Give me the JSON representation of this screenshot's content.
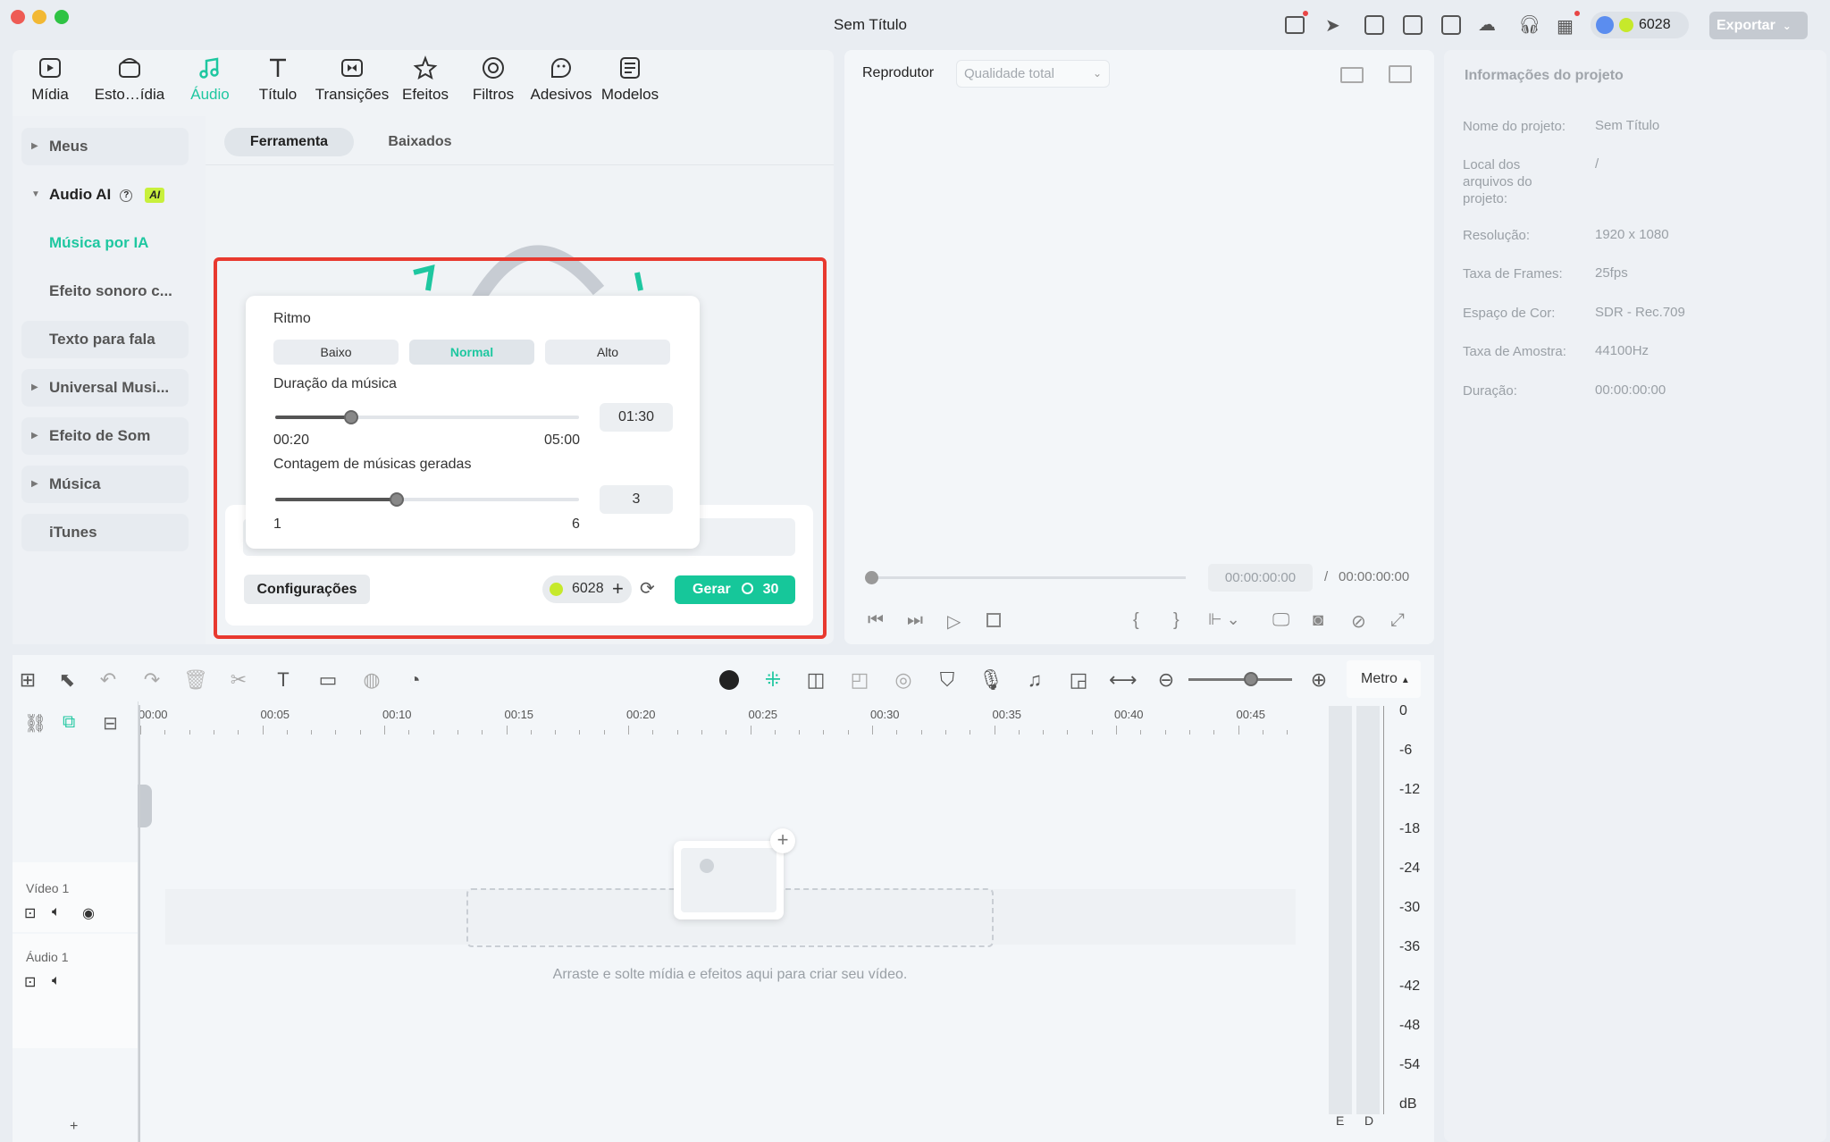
{
  "window": {
    "title": "Sem Título",
    "credits": "6028",
    "export_label": "Exportar"
  },
  "media_tabs": [
    {
      "label": "Mídia",
      "icon": "media-icon"
    },
    {
      "label": "Esto…ídia",
      "icon": "stock-media-icon"
    },
    {
      "label": "Áudio",
      "icon": "music-note-icon"
    },
    {
      "label": "Título",
      "icon": "text-icon"
    },
    {
      "label": "Transições",
      "icon": "transition-icon"
    },
    {
      "label": "Efeitos",
      "icon": "effects-icon"
    },
    {
      "label": "Filtros",
      "icon": "filter-icon"
    },
    {
      "label": "Adesivos",
      "icon": "sticker-icon"
    },
    {
      "label": "Modelos",
      "icon": "template-icon"
    }
  ],
  "sidebar": {
    "items": [
      {
        "label": "Meus"
      },
      {
        "label": "Audio AI",
        "badge": "AI"
      },
      {
        "label": "Música por IA"
      },
      {
        "label": "Efeito sonoro c..."
      },
      {
        "label": "Texto para fala"
      },
      {
        "label": "Universal Musi..."
      },
      {
        "label": "Efeito de Som"
      },
      {
        "label": "Música"
      },
      {
        "label": "iTunes"
      }
    ]
  },
  "subtabs": {
    "tool": "Ferramenta",
    "downloaded": "Baixados"
  },
  "ai_panel": {
    "rhythm_label": "Ritmo",
    "rhythm_options": [
      "Baixo",
      "Normal",
      "Alto"
    ],
    "rhythm_selected": "Normal",
    "duration_label": "Duração da música",
    "duration_value": "01:30",
    "duration_min": "00:20",
    "duration_max": "05:00",
    "duration_fraction": 0.25,
    "count_label": "Contagem de músicas geradas",
    "count_value": "3",
    "count_min": "1",
    "count_max": "6",
    "count_fraction": 0.4,
    "settings_label": "Configurações",
    "credits": "6028",
    "generate_label": "Gerar",
    "generate_cost": "30"
  },
  "player": {
    "title": "Reprodutor",
    "quality": "Qualidade total",
    "current_time": "00:00:00:00",
    "separator": "/",
    "total_time": "00:00:00:00"
  },
  "project_info": {
    "title": "Informações do projeto",
    "rows": [
      {
        "key": "Nome do projeto:",
        "value": "Sem Título"
      },
      {
        "key": "Local dos arquivos do projeto:",
        "value": "/"
      },
      {
        "key": "Resolução:",
        "value": "1920 x 1080"
      },
      {
        "key": "Taxa de Frames:",
        "value": "25fps"
      },
      {
        "key": "Espaço de Cor:",
        "value": "SDR - Rec.709"
      },
      {
        "key": "Taxa de Amostra:",
        "value": "44100Hz"
      },
      {
        "key": "Duração:",
        "value": "00:00:00:00"
      }
    ]
  },
  "timeline": {
    "meter_label": "Metro",
    "ticks": [
      "00:00",
      "00:05",
      "00:10",
      "00:15",
      "00:20",
      "00:25",
      "00:30",
      "00:35",
      "00:40",
      "00:45"
    ],
    "tracks": [
      {
        "label": "Vídeo 1"
      },
      {
        "label": "Áudio 1"
      }
    ],
    "drop_hint": "Arraste e solte mídia e efeitos aqui para criar seu vídeo.",
    "db_scale": [
      "0",
      "-6",
      "-12",
      "-18",
      "-24",
      "-30",
      "-36",
      "-42",
      "-48",
      "-54",
      "dB"
    ],
    "channels": [
      "E",
      "D"
    ]
  },
  "colors": {
    "accent": "#1ec7a0",
    "highlight_border": "#e8392f",
    "generate_bg": "#16c79a"
  }
}
